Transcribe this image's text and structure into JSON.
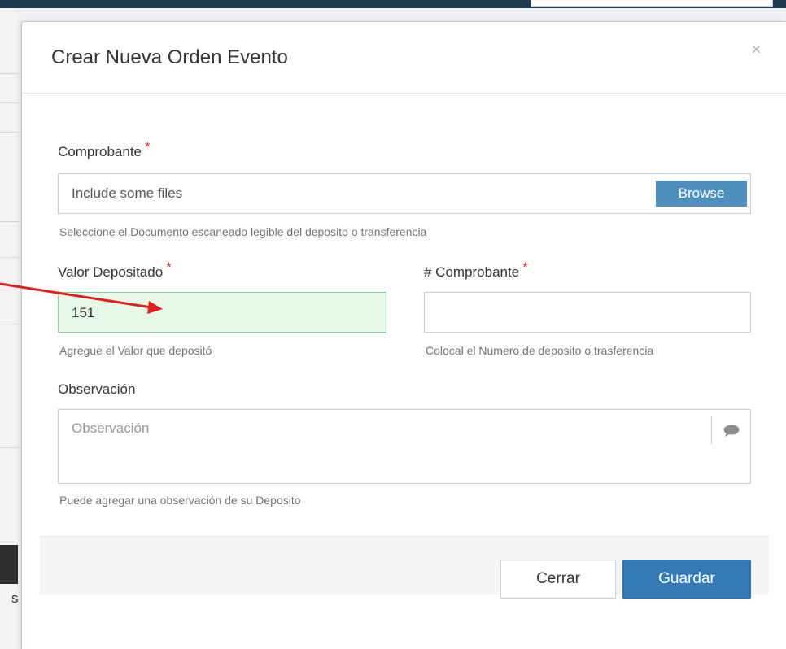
{
  "modal": {
    "title": "Crear Nueva Orden Evento",
    "close_symbol": "×"
  },
  "form": {
    "comprobante": {
      "label": "Comprobante",
      "required_mark": "*",
      "placeholder": "Include some files",
      "browse_label": "Browse",
      "help": "Seleccione el Documento escaneado legible del deposito o transferencia"
    },
    "valor_depositado": {
      "label": "Valor Depositado",
      "required_mark": "*",
      "value": "151",
      "help": "Agregue el Valor que depositó"
    },
    "numero_comprobante": {
      "label": "# Comprobante",
      "required_mark": "*",
      "value": "",
      "help": "Colocal el Numero de deposito o trasferencia"
    },
    "observacion": {
      "label": "Observación",
      "placeholder": "Observación",
      "icon": "comment-icon",
      "help": "Puede agregar una observación de su Deposito"
    }
  },
  "footer": {
    "close_label": "Cerrar",
    "save_label": "Guardar"
  },
  "background": {
    "partial_letter": "s"
  },
  "colors": {
    "primary": "#337ab7",
    "browse": "#4f8fc0",
    "required": "#c9302c",
    "valid_bg": "#e8f8e8",
    "valid_border": "#8ad49c",
    "arrow": "#e0201b"
  }
}
